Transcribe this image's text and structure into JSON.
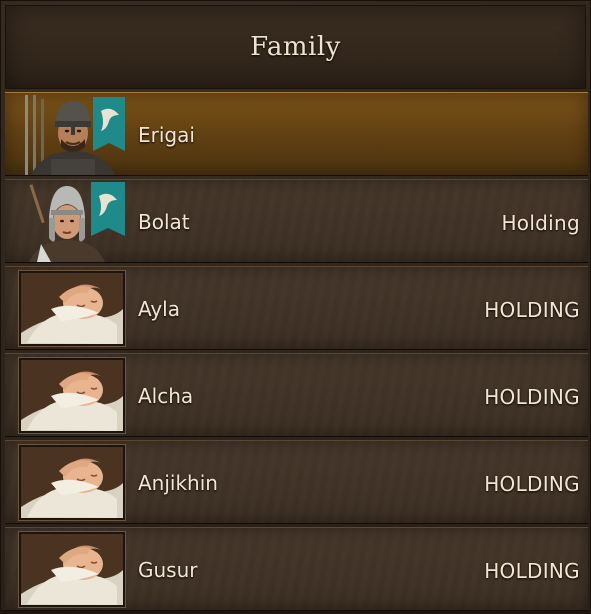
{
  "header": {
    "title": "Family"
  },
  "members": [
    {
      "name": "Erigai",
      "status": "",
      "portrait": "warrior-portrait-icon",
      "banner": "eagle-banner-icon",
      "selected": true
    },
    {
      "name": "Bolat",
      "status": "Holding",
      "portrait": "helmeted-woman-portrait-icon",
      "banner": "eagle-banner-icon",
      "selected": false
    },
    {
      "name": "Ayla",
      "status": "HOLDING",
      "portrait": "sleeping-baby-portrait-icon",
      "selected": false
    },
    {
      "name": "Alcha",
      "status": "HOLDING",
      "portrait": "sleeping-baby-portrait-icon",
      "selected": false
    },
    {
      "name": "Anjikhin",
      "status": "HOLDING",
      "portrait": "sleeping-baby-portrait-icon",
      "selected": false
    },
    {
      "name": "Gusur",
      "status": "HOLDING",
      "portrait": "sleeping-baby-portrait-icon",
      "selected": false
    }
  ],
  "colors": {
    "selected_row": "#6a4716",
    "row": "#413327",
    "banner": "#1f8a8a",
    "text": "#f2e6d2"
  }
}
